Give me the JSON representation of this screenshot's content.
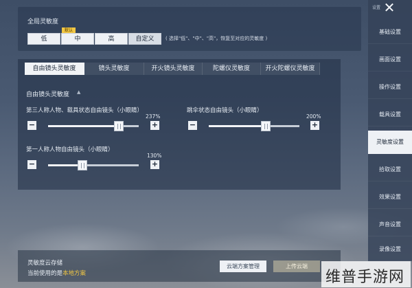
{
  "global": {
    "title": "全局灵敏度",
    "default_badge": "默认",
    "options": [
      "低",
      "中",
      "高",
      "自定义"
    ],
    "hint": "( 选择\"低\"、\"中\"、\"高\"，恢复至对应的灵敏度 )"
  },
  "tabs": [
    "自由镜头灵敏度",
    "镜头灵敏度",
    "开火镜头灵敏度",
    "陀螺仪灵敏度",
    "开火陀螺仪灵敏度"
  ],
  "section": {
    "title": "自由镜头灵敏度",
    "caret": "▲"
  },
  "sliders": [
    {
      "label": "第三人称人物、载具状态自由镜头（小眼睛）",
      "percent_text": "237%",
      "value": 0.78
    },
    {
      "label": "跳伞状态自由镜头（小眼睛）",
      "percent_text": "200%",
      "value": 0.63
    },
    {
      "label": "第一人称人物自由镜头（小眼睛）",
      "percent_text": "130%",
      "value": 0.38
    }
  ],
  "buttons": {
    "minus": "−",
    "plus": "+"
  },
  "sidebar": {
    "header": "设置",
    "close": "✕",
    "items": [
      "基础设置",
      "画面设置",
      "操作设置",
      "载具设置",
      "灵敏度设置",
      "拾取设置",
      "效果设置",
      "声音设置",
      "录像设置"
    ],
    "active_index": 4
  },
  "bottom": {
    "title": "灵敏度云存储",
    "current_prefix": "当前使用的是",
    "current_value": "本地方案",
    "cloud_button": "云端方案管理",
    "upload_button": "上传云端"
  },
  "watermark": "维普手游网",
  "colors": {
    "accent_yellow": "#f2c744",
    "panel_bg": "#22304a",
    "active_tab": "#f1f3f6"
  }
}
